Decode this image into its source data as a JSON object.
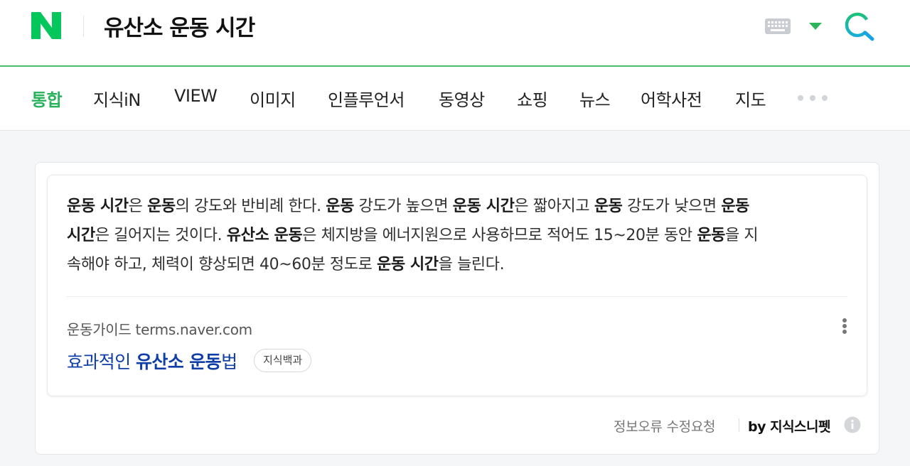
{
  "header": {
    "logo_letter": "N",
    "query": "유산소 운동 시간",
    "icons": {
      "keyboard": "keyboard-icon",
      "dropdown": "caret-down-icon",
      "search": "search-icon"
    }
  },
  "tabs": [
    {
      "label": "통합",
      "active": true
    },
    {
      "label": "지식iN"
    },
    {
      "label": "VIEW"
    },
    {
      "label": "이미지"
    },
    {
      "label": "인플루언서"
    },
    {
      "label": "동영상"
    },
    {
      "label": "쇼핑"
    },
    {
      "label": "뉴스"
    },
    {
      "label": "어학사전"
    },
    {
      "label": "지도"
    }
  ],
  "answer": {
    "lines": [
      [
        {
          "t": "운동 시간",
          "b": true
        },
        {
          "t": "은 "
        },
        {
          "t": "운동",
          "b": true
        },
        {
          "t": "의 강도와 반비례 한다. "
        },
        {
          "t": "운동",
          "b": true
        },
        {
          "t": " 강도가 높으면 "
        },
        {
          "t": "운동 시간",
          "b": true
        },
        {
          "t": "은 짧아지고 "
        },
        {
          "t": "운동",
          "b": true
        },
        {
          "t": " 강도가 낮으면 "
        },
        {
          "t": "운동",
          "b": true
        }
      ],
      [
        {
          "t": "시간",
          "b": true
        },
        {
          "t": "은 길어지는 것이다. "
        },
        {
          "t": "유산소 운동",
          "b": true
        },
        {
          "t": "은 체지방을 에너지원으로 사용하므로 적어도 15~20분 동안 "
        },
        {
          "t": "운동",
          "b": true
        },
        {
          "t": "을 지"
        }
      ],
      [
        {
          "t": "속해야 하고, 체력이 향상되면 40~60분 정도로 "
        },
        {
          "t": "운동 시간",
          "b": true
        },
        {
          "t": "을 늘린다."
        }
      ]
    ],
    "source": "운동가이드 terms.naver.com",
    "doc_title": [
      {
        "t": "효과적인 "
      },
      {
        "t": "유산소 운동",
        "b": true
      },
      {
        "t": "법"
      }
    ],
    "badge": "지식백과",
    "more_icon": "more-vertical-icon"
  },
  "footer": {
    "report": "정보오류 수정요청",
    "by": "by 지식스니펫",
    "info_icon": "info-icon"
  },
  "colors": {
    "brand_green": "#03c75a",
    "active_tab": "#29b25c",
    "link_blue": "#0f3fa6",
    "header_line": "#4cbb6c"
  }
}
